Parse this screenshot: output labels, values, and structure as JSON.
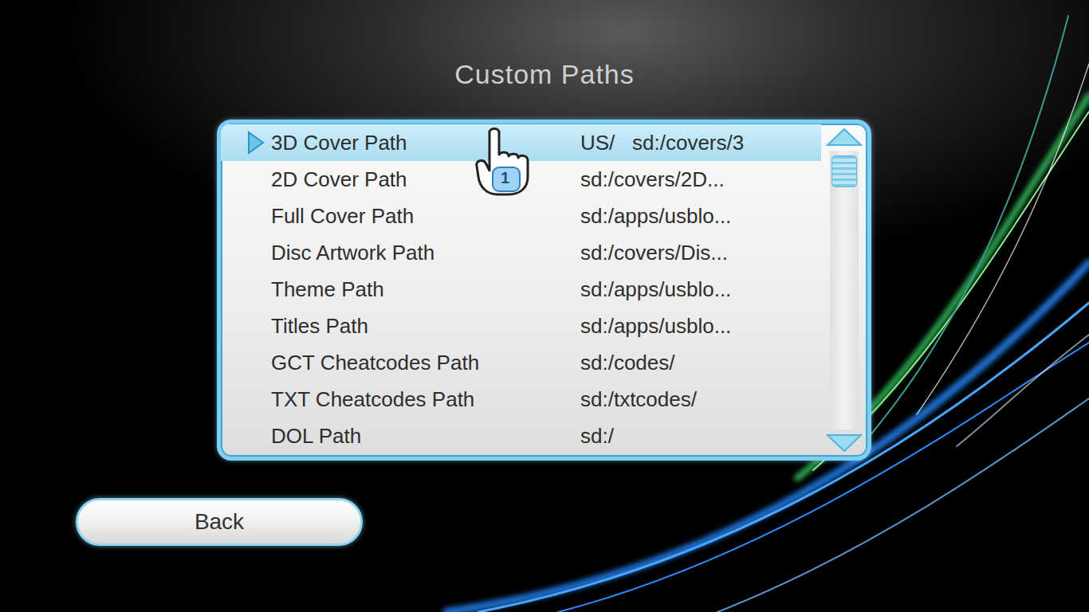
{
  "screen": {
    "title": "Custom Paths"
  },
  "paths": [
    {
      "label": "3D Cover Path",
      "value": "US/   sd:/covers/3",
      "selected": true
    },
    {
      "label": "2D Cover Path",
      "value": "sd:/covers/2D...",
      "selected": false
    },
    {
      "label": "Full Cover Path",
      "value": "sd:/apps/usblo...",
      "selected": false
    },
    {
      "label": "Disc Artwork Path",
      "value": "sd:/covers/Dis...",
      "selected": false
    },
    {
      "label": "Theme Path",
      "value": "sd:/apps/usblo...",
      "selected": false
    },
    {
      "label": "Titles Path",
      "value": "sd:/apps/usblo...",
      "selected": false
    },
    {
      "label": "GCT Cheatcodes Path",
      "value": "sd:/codes/",
      "selected": false
    },
    {
      "label": "TXT Cheatcodes Path",
      "value": "sd:/txtcodes/",
      "selected": false
    },
    {
      "label": "DOL Path",
      "value": "sd:/",
      "selected": false
    }
  ],
  "scrollbar": {
    "level": 0
  },
  "pointer": {
    "label": "1"
  },
  "buttons": [
    {
      "label": "Back"
    }
  ]
}
